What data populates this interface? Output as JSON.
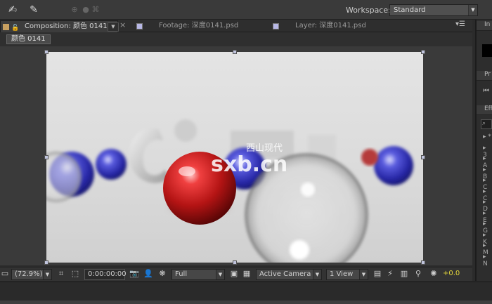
{
  "toolbar": {
    "workspace_label": "Workspace:",
    "workspace_value": "Standard"
  },
  "tabs": {
    "composition": "Composition: 颜色 0141",
    "footage": "Footage: 深度0141.psd",
    "layer": "Layer: 深度0141.psd",
    "close_glyph": "×",
    "menu_glyph": "▾☰"
  },
  "comp_label": "颜色 0141",
  "viewer_controls": {
    "zoom": "(72.9%)",
    "timecode": "0:00:00:00",
    "resolution": "Full",
    "camera": "Active Camera",
    "views": "1 View",
    "exposure": "+0.0"
  },
  "right_panel": {
    "info_label": "In",
    "preview_label": "Pr",
    "effects_label": "Eff",
    "effects_items": [
      "*",
      "3",
      "A",
      "B",
      "C",
      "C",
      "D",
      "E",
      "G",
      "K",
      "M",
      "N"
    ]
  },
  "watermark": {
    "cn": "西山现代",
    "en": "sxb.cn"
  },
  "colors": {
    "accent": "#e3d63b",
    "red_ball": "#c81c1c",
    "blue_ball": "#3536b8"
  }
}
